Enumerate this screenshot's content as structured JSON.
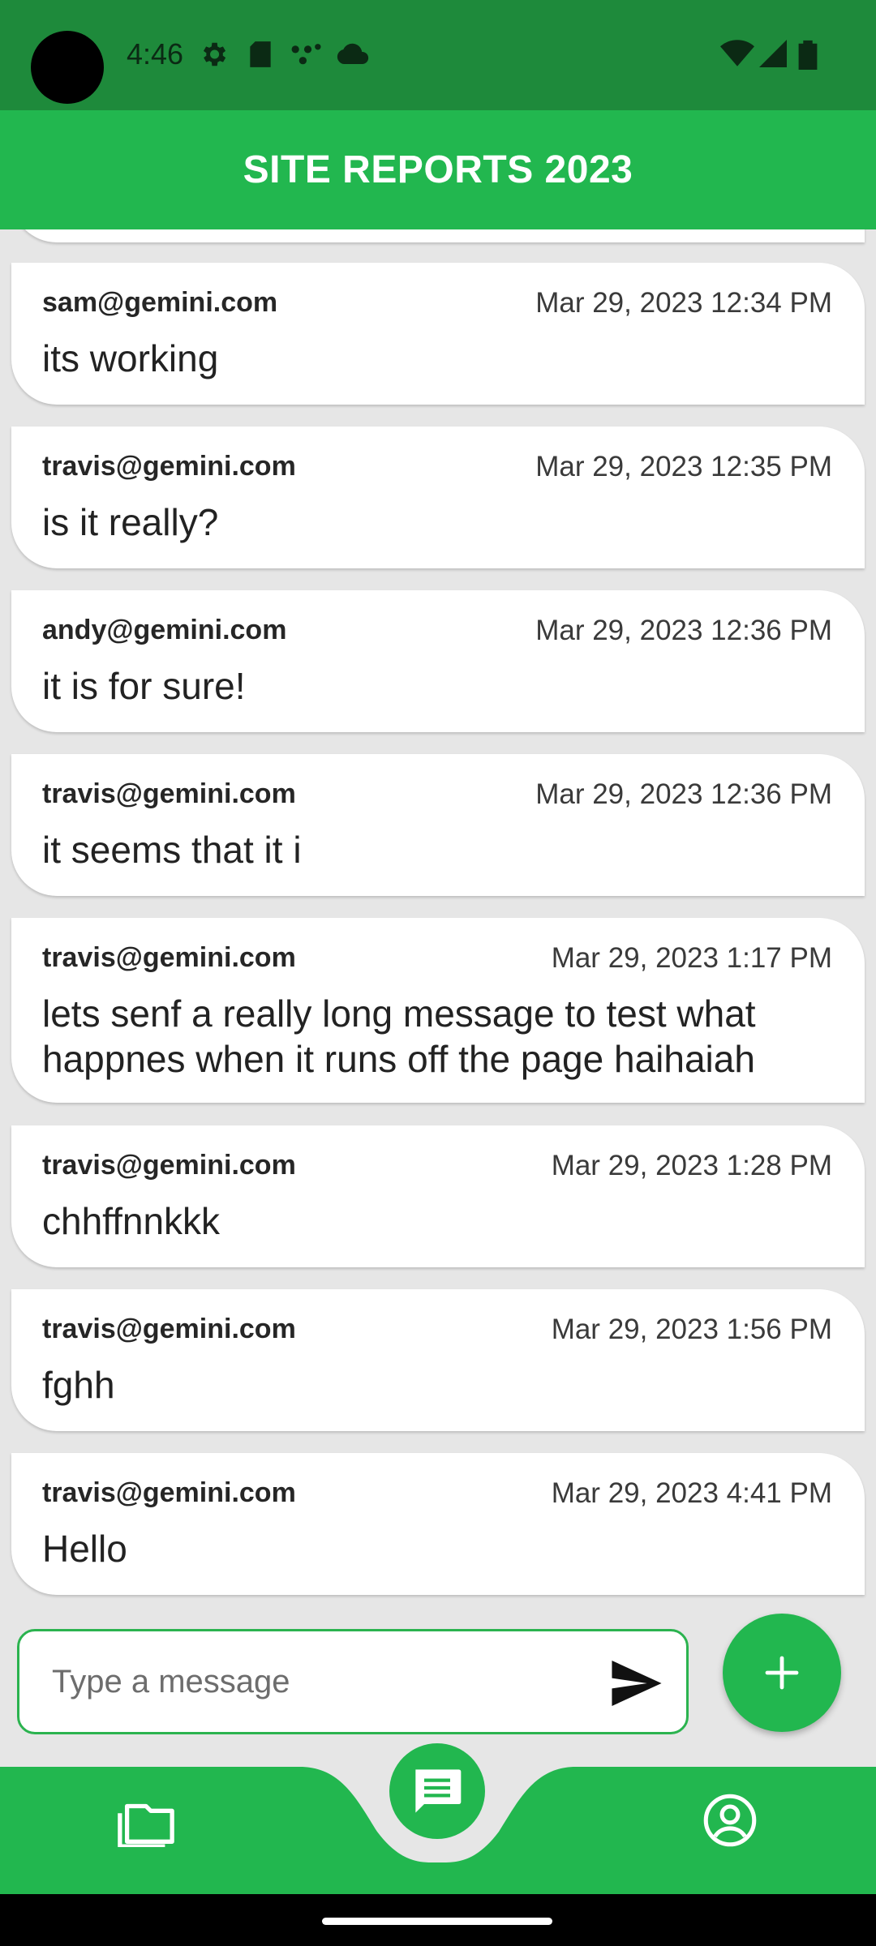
{
  "status_bar": {
    "time": "4:46",
    "left_icons": [
      "settings-gear-icon",
      "sd-card-icon",
      "dots-icon",
      "cloud-icon"
    ],
    "right_icons": [
      "wifi-icon",
      "cell-signal-icon",
      "battery-icon"
    ]
  },
  "app_bar": {
    "title": "SITE REPORTS 2023"
  },
  "messages": [
    {
      "sender": "sam@gemini.com",
      "time": "Mar 29, 2023 12:34 PM",
      "text": "its working"
    },
    {
      "sender": "travis@gemini.com",
      "time": "Mar 29, 2023 12:35 PM",
      "text": "is it really?"
    },
    {
      "sender": "andy@gemini.com",
      "time": "Mar 29, 2023 12:36 PM",
      "text": "it is for sure!"
    },
    {
      "sender": "travis@gemini.com",
      "time": "Mar 29, 2023 12:36 PM",
      "text": "it seems that it i"
    },
    {
      "sender": "travis@gemini.com",
      "time": "Mar 29, 2023 1:17 PM",
      "text": "lets senf a really long message to test what happnes when it runs off the page haihaiah"
    },
    {
      "sender": "travis@gemini.com",
      "time": "Mar 29, 2023 1:28 PM",
      "text": "chhffnnkkk"
    },
    {
      "sender": "travis@gemini.com",
      "time": "Mar 29, 2023 1:56 PM",
      "text": "fghh"
    },
    {
      "sender": "travis@gemini.com",
      "time": "Mar 29, 2023 4:41 PM",
      "text": "Hello"
    }
  ],
  "composer": {
    "placeholder": "Type a message",
    "value": "",
    "send_icon": "send-icon",
    "add_icon": "plus-icon"
  },
  "bottom_nav": {
    "items": [
      {
        "icon": "folder-icon",
        "name": "files"
      },
      {
        "icon": "chat-icon",
        "name": "messages",
        "active": true
      },
      {
        "icon": "account-circle-icon",
        "name": "profile"
      }
    ]
  },
  "colors": {
    "status_bar": "#1e8a3b",
    "primary": "#22b74f",
    "background": "#e6e6e6",
    "card": "#ffffff"
  }
}
